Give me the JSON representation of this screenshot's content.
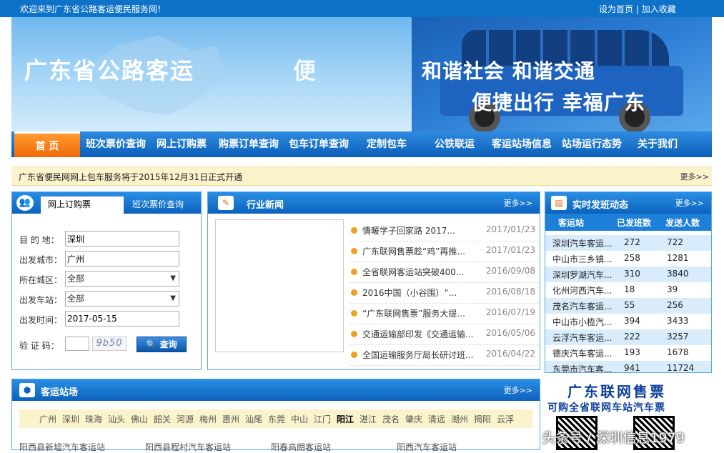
{
  "topbar": {
    "welcome": "欢迎来到广东省公路客运便民服务网！",
    "set_home": "设为首页",
    "sep": " | ",
    "favorite": "加入收藏"
  },
  "banner": {
    "title": "广东省公路客运",
    "bian": "便",
    "slogan1": "和谐社会  和谐交通",
    "slogan2": "便捷出行 幸福广东"
  },
  "nav": [
    "首 页",
    "班次票价查询",
    "网上订购票",
    "购票订单查询",
    "包车订单查询",
    "定制包车",
    "公铁联运",
    "客运站场信息",
    "站场运行态势",
    "关于我们"
  ],
  "notice": {
    "text": "广东省便民网网上包车服务将于2015年12月31日正式开通",
    "more": "更多>>"
  },
  "booking": {
    "tab_active": "网上订购票",
    "tab_other": "班次票价查询",
    "dest_label": "目 的 地：",
    "dest_value": "深圳",
    "from_label": "出发城市：",
    "from_value": "广州",
    "district_label": "所在城区：",
    "district_value": "全部",
    "station_label": "出发车站：",
    "station_value": "全部",
    "date_label": "出发时间：",
    "date_value": "2017-05-15",
    "captcha_label": "验 证 码：",
    "captcha_text": "9b50",
    "query": "查询"
  },
  "news": {
    "title": "行业新闻",
    "more": "更多>>",
    "items": [
      {
        "title": "情暖学子回家路 2017...",
        "date": "2017/01/23"
      },
      {
        "title": "广东联网售票趁“鸡”再推...",
        "date": "2017/01/23"
      },
      {
        "title": "全省联网客运站突破400...",
        "date": "2016/09/08"
      },
      {
        "title": "2016中国（小谷围）“...",
        "date": "2016/08/18"
      },
      {
        "title": "“广东联网售票”服务大提...",
        "date": "2016/07/19"
      },
      {
        "title": "交通运输部印发《交通运输...",
        "date": "2016/05/06"
      },
      {
        "title": "全国运输服务厅局长研讨班...",
        "date": "2016/04/22"
      }
    ]
  },
  "live": {
    "title": "实时发班动态",
    "more": "更多>>",
    "cols": [
      "客运站",
      "已发班数",
      "发送人数"
    ],
    "rows": [
      [
        "深圳汽车客运...",
        "272",
        "722"
      ],
      [
        "中山市三乡镇...",
        "258",
        "1281"
      ],
      [
        "深圳罗湖汽车...",
        "310",
        "3840"
      ],
      [
        "化州河西汽车...",
        "18",
        "39"
      ],
      [
        "茂名汽车客运...",
        "55",
        "256"
      ],
      [
        "中山市小榄汽...",
        "394",
        "3433"
      ],
      [
        "云浮汽车客运...",
        "222",
        "3257"
      ],
      [
        "德庆汽车客运...",
        "193",
        "1678"
      ],
      [
        "东莞市汽车客...",
        "941",
        "11724"
      ]
    ]
  },
  "stations": {
    "title": "客运站场",
    "more": "更多>>",
    "cities": [
      "广州",
      "深圳",
      "珠海",
      "汕头",
      "佛山",
      "韶关",
      "河源",
      "梅州",
      "惠州",
      "汕尾",
      "东莞",
      "中山",
      "江门",
      "阳江",
      "湛江",
      "茂名",
      "肇庆",
      "清远",
      "潮州",
      "揭阳",
      "云浮"
    ],
    "list": [
      "阳西县新墟汽车客运站",
      "阳西县程村汽车客运站",
      "阳春高朗客运站",
      "阳西汽车客运站"
    ]
  },
  "promo": {
    "line1": "广东联网售票",
    "line2": "可购全省联网车站汽车票"
  },
  "watermark": "头条号 / 深圳信息1979"
}
